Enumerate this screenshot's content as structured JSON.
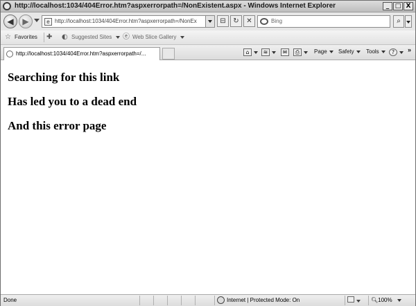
{
  "window": {
    "title": "http://localhost:1034/404Error.htm?aspxerrorpath=/NonExistent.aspx - Windows Internet Explorer",
    "controls": [
      "_",
      "□",
      "X"
    ]
  },
  "address_bar": {
    "url": "http://localhost:1034/404Error.htm?aspxerrorpath=/NonEx"
  },
  "search": {
    "placeholder": "Bing"
  },
  "favorites_bar": {
    "favorites_label": "Favorites",
    "suggested_label": "Suggested Sites",
    "webslice_label": "Web Slice Gallery"
  },
  "tab": {
    "label": "http://localhost:1034/404Error.htm?aspxerrorpath=/..."
  },
  "command_bar": {
    "page": "Page",
    "safety": "Safety",
    "tools": "Tools",
    "more": "»"
  },
  "content": {
    "line1": "Searching for this link",
    "line2": "Has led you to a dead end",
    "line3": "And this error page"
  },
  "status_bar": {
    "status": "Done",
    "zone": "Internet | Protected Mode: On",
    "zoom": "100%"
  }
}
